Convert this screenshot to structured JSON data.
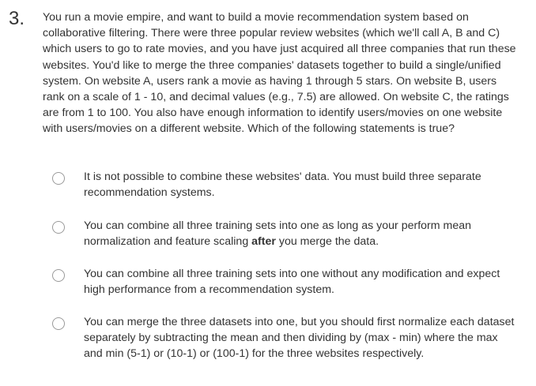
{
  "question": {
    "number": "3.",
    "stem": "You run a movie empire, and want to build a movie recommendation system based on collaborative filtering. There were three popular review websites (which we'll call A, B and C) which users to go to rate movies, and you have just acquired all three companies that run these websites. You'd like to merge the three companies' datasets together to build a single/unified system. On website A, users rank a movie as having 1 through 5 stars. On website B, users rank on a scale of 1 - 10, and decimal values (e.g., 7.5) are allowed. On website C, the ratings are from 1 to 100. You also have enough information to identify users/movies on one website with users/movies on a different website. Which of the following statements is true?",
    "options": [
      {
        "text": "It is not possible to combine these websites' data. You must build three separate recommendation systems.",
        "selected": false
      },
      {
        "text_before": "You can combine all three training sets into one as long as your perform mean normalization and feature scaling ",
        "text_bold": "after",
        "text_after": " you merge the data.",
        "selected": false
      },
      {
        "text": "You can combine all three training sets into one without any modification and expect high performance from a recommendation system.",
        "selected": false
      },
      {
        "text": "You can merge the three datasets into one, but you should first normalize each dataset separately by subtracting the mean and then dividing by (max - min) where the max and min (5-1) or (10-1) or (100-1) for the three websites respectively.",
        "selected": false
      }
    ]
  }
}
